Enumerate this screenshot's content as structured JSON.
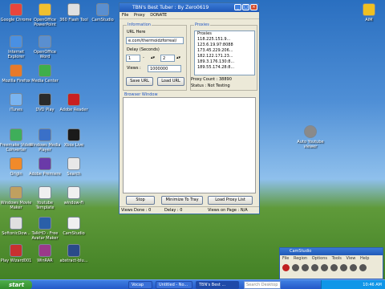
{
  "desktop": {
    "icons_left": [
      {
        "label": "Google Chrome"
      },
      {
        "label": "OpenOffice PowerPoint"
      },
      {
        "label": "360 Flash Tool"
      },
      {
        "label": "CamStudio"
      },
      {
        "label": "Internet Explorer"
      },
      {
        "label": "OpenOffice Word"
      },
      {
        "label": "Mozilla Firefox"
      },
      {
        "label": "Media Center"
      },
      {
        "label": "iTunes"
      },
      {
        "label": "DVD Play"
      },
      {
        "label": "Adobe Reader"
      },
      {
        "label": "Freemake Video Converter"
      },
      {
        "label": "Windows Media Player"
      },
      {
        "label": "Xbox Live"
      },
      {
        "label": "Origin"
      },
      {
        "label": "Adobe Premiere"
      },
      {
        "label": "Search"
      },
      {
        "label": "Windows Movie Maker"
      },
      {
        "label": "Youtube Template"
      },
      {
        "label": "window-Fi"
      },
      {
        "label": "SoftonicDow..."
      },
      {
        "label": "TalkHD - Free Avatar Maker"
      },
      {
        "label": "CamStudio"
      },
      {
        "label": "Play Wizard001"
      },
      {
        "label": "WinRAR"
      },
      {
        "label": "abstract-blu..."
      }
    ],
    "right_icons": [
      {
        "label": "AIM"
      },
      {
        "label": "Auto Youtube viewer"
      }
    ]
  },
  "app": {
    "title": "TBN's Best Tuber : By Zero0619",
    "menu": [
      "File",
      "Proxy",
      "DONATE"
    ],
    "information_title": "Information",
    "url_label": "URL Here",
    "url_value": "e.com/thermoidzforreal/",
    "delay_label": "Delay (Seconds)",
    "delay_from": "1",
    "delay_to": "2",
    "delay_sep": "-",
    "views_label": "Views :",
    "views_value": "1000000",
    "save_url": "Save URL",
    "load_url": "Load URL",
    "proxies_title": "Proxies",
    "proxies": [
      "Proxies",
      "118.225.151.9...",
      "123.6.19.97:8088",
      "173.45.229.206...",
      "182.122.171.23...",
      "189.3.176.130:8...",
      "189.55.174.28:8..."
    ],
    "proxy_count": "Proxy Count : 38890",
    "status": "Status : Not Testing",
    "browser_title": "Browser Window",
    "stop_button": "Stop",
    "minimize_button": "Minimize To Tray",
    "load_proxy_button": "Load Proxy List",
    "views_done": "Views Done : 0",
    "delay_status": "Delay : 0",
    "views_on_page": "Views on Page : N/A"
  },
  "camstudio": {
    "title": "CamStudio",
    "menu": [
      "File",
      "Region",
      "Options",
      "Tools",
      "View",
      "Help"
    ]
  },
  "taskbar": {
    "start": "start",
    "tasks": [
      "Vocap",
      "Untitled - No...",
      "TBN's Best ...",
      "CamStudio"
    ],
    "search_placeholder": "Search Desktop",
    "clock": "10:46 AM"
  }
}
